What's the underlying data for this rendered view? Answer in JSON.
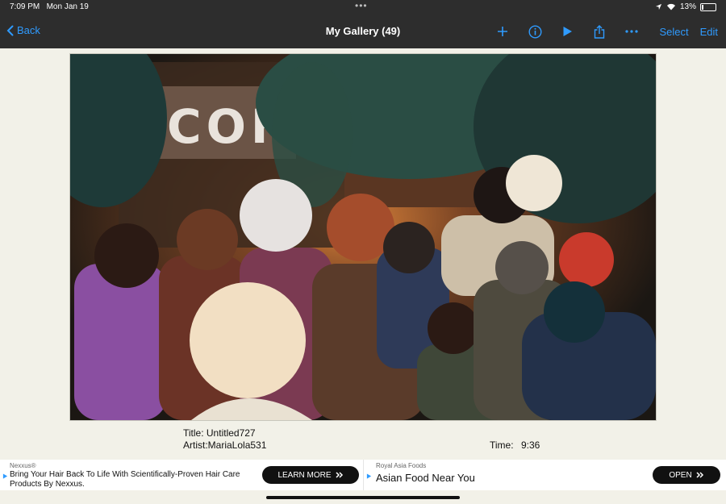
{
  "status_bar": {
    "time": "7:09 PM",
    "date": "Mon Jan 19",
    "battery": "13%"
  },
  "nav": {
    "back_label": "Back",
    "title": "My Gallery (49)",
    "select_label": "Select",
    "edit_label": "Edit",
    "icons": [
      "chevron-left-icon",
      "plus-icon",
      "info-icon",
      "play-icon",
      "share-icon",
      "more-icon"
    ]
  },
  "artwork": {
    "sign_text": "COFF"
  },
  "details": {
    "title_label": "Title: Untitled727",
    "artist_label": "Artist:MariaLola531",
    "time_label": "Time:",
    "time_value": "9:36"
  },
  "ads": [
    {
      "sponsor": "Nexxus®",
      "headline": "Bring Your Hair Back To Life With Scientifically-Proven Hair Care Products By Nexxus.",
      "button": "LEARN MORE"
    },
    {
      "sponsor": "Royal Asia Foods",
      "headline": "Asian Food Near You",
      "button": "OPEN"
    }
  ],
  "colors": {
    "accent": "#2f9bff",
    "bar_bg": "#2d2d2d",
    "page_bg": "#f2f1e8"
  }
}
